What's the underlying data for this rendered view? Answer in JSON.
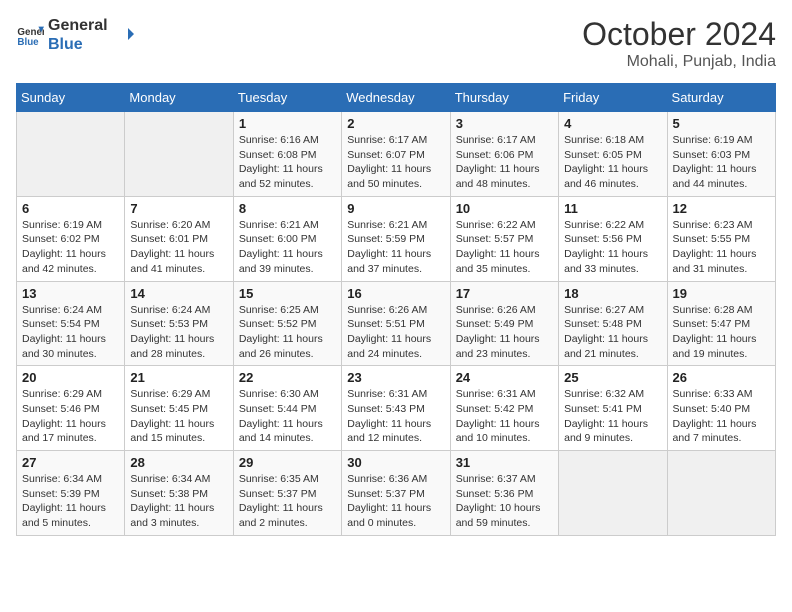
{
  "header": {
    "logo_line1": "General",
    "logo_line2": "Blue",
    "month_title": "October 2024",
    "location": "Mohali, Punjab, India"
  },
  "days_of_week": [
    "Sunday",
    "Monday",
    "Tuesday",
    "Wednesday",
    "Thursday",
    "Friday",
    "Saturday"
  ],
  "weeks": [
    [
      {
        "day": "",
        "content": ""
      },
      {
        "day": "",
        "content": ""
      },
      {
        "day": "1",
        "content": "Sunrise: 6:16 AM\nSunset: 6:08 PM\nDaylight: 11 hours and 52 minutes."
      },
      {
        "day": "2",
        "content": "Sunrise: 6:17 AM\nSunset: 6:07 PM\nDaylight: 11 hours and 50 minutes."
      },
      {
        "day": "3",
        "content": "Sunrise: 6:17 AM\nSunset: 6:06 PM\nDaylight: 11 hours and 48 minutes."
      },
      {
        "day": "4",
        "content": "Sunrise: 6:18 AM\nSunset: 6:05 PM\nDaylight: 11 hours and 46 minutes."
      },
      {
        "day": "5",
        "content": "Sunrise: 6:19 AM\nSunset: 6:03 PM\nDaylight: 11 hours and 44 minutes."
      }
    ],
    [
      {
        "day": "6",
        "content": "Sunrise: 6:19 AM\nSunset: 6:02 PM\nDaylight: 11 hours and 42 minutes."
      },
      {
        "day": "7",
        "content": "Sunrise: 6:20 AM\nSunset: 6:01 PM\nDaylight: 11 hours and 41 minutes."
      },
      {
        "day": "8",
        "content": "Sunrise: 6:21 AM\nSunset: 6:00 PM\nDaylight: 11 hours and 39 minutes."
      },
      {
        "day": "9",
        "content": "Sunrise: 6:21 AM\nSunset: 5:59 PM\nDaylight: 11 hours and 37 minutes."
      },
      {
        "day": "10",
        "content": "Sunrise: 6:22 AM\nSunset: 5:57 PM\nDaylight: 11 hours and 35 minutes."
      },
      {
        "day": "11",
        "content": "Sunrise: 6:22 AM\nSunset: 5:56 PM\nDaylight: 11 hours and 33 minutes."
      },
      {
        "day": "12",
        "content": "Sunrise: 6:23 AM\nSunset: 5:55 PM\nDaylight: 11 hours and 31 minutes."
      }
    ],
    [
      {
        "day": "13",
        "content": "Sunrise: 6:24 AM\nSunset: 5:54 PM\nDaylight: 11 hours and 30 minutes."
      },
      {
        "day": "14",
        "content": "Sunrise: 6:24 AM\nSunset: 5:53 PM\nDaylight: 11 hours and 28 minutes."
      },
      {
        "day": "15",
        "content": "Sunrise: 6:25 AM\nSunset: 5:52 PM\nDaylight: 11 hours and 26 minutes."
      },
      {
        "day": "16",
        "content": "Sunrise: 6:26 AM\nSunset: 5:51 PM\nDaylight: 11 hours and 24 minutes."
      },
      {
        "day": "17",
        "content": "Sunrise: 6:26 AM\nSunset: 5:49 PM\nDaylight: 11 hours and 23 minutes."
      },
      {
        "day": "18",
        "content": "Sunrise: 6:27 AM\nSunset: 5:48 PM\nDaylight: 11 hours and 21 minutes."
      },
      {
        "day": "19",
        "content": "Sunrise: 6:28 AM\nSunset: 5:47 PM\nDaylight: 11 hours and 19 minutes."
      }
    ],
    [
      {
        "day": "20",
        "content": "Sunrise: 6:29 AM\nSunset: 5:46 PM\nDaylight: 11 hours and 17 minutes."
      },
      {
        "day": "21",
        "content": "Sunrise: 6:29 AM\nSunset: 5:45 PM\nDaylight: 11 hours and 15 minutes."
      },
      {
        "day": "22",
        "content": "Sunrise: 6:30 AM\nSunset: 5:44 PM\nDaylight: 11 hours and 14 minutes."
      },
      {
        "day": "23",
        "content": "Sunrise: 6:31 AM\nSunset: 5:43 PM\nDaylight: 11 hours and 12 minutes."
      },
      {
        "day": "24",
        "content": "Sunrise: 6:31 AM\nSunset: 5:42 PM\nDaylight: 11 hours and 10 minutes."
      },
      {
        "day": "25",
        "content": "Sunrise: 6:32 AM\nSunset: 5:41 PM\nDaylight: 11 hours and 9 minutes."
      },
      {
        "day": "26",
        "content": "Sunrise: 6:33 AM\nSunset: 5:40 PM\nDaylight: 11 hours and 7 minutes."
      }
    ],
    [
      {
        "day": "27",
        "content": "Sunrise: 6:34 AM\nSunset: 5:39 PM\nDaylight: 11 hours and 5 minutes."
      },
      {
        "day": "28",
        "content": "Sunrise: 6:34 AM\nSunset: 5:38 PM\nDaylight: 11 hours and 3 minutes."
      },
      {
        "day": "29",
        "content": "Sunrise: 6:35 AM\nSunset: 5:37 PM\nDaylight: 11 hours and 2 minutes."
      },
      {
        "day": "30",
        "content": "Sunrise: 6:36 AM\nSunset: 5:37 PM\nDaylight: 11 hours and 0 minutes."
      },
      {
        "day": "31",
        "content": "Sunrise: 6:37 AM\nSunset: 5:36 PM\nDaylight: 10 hours and 59 minutes."
      },
      {
        "day": "",
        "content": ""
      },
      {
        "day": "",
        "content": ""
      }
    ]
  ]
}
